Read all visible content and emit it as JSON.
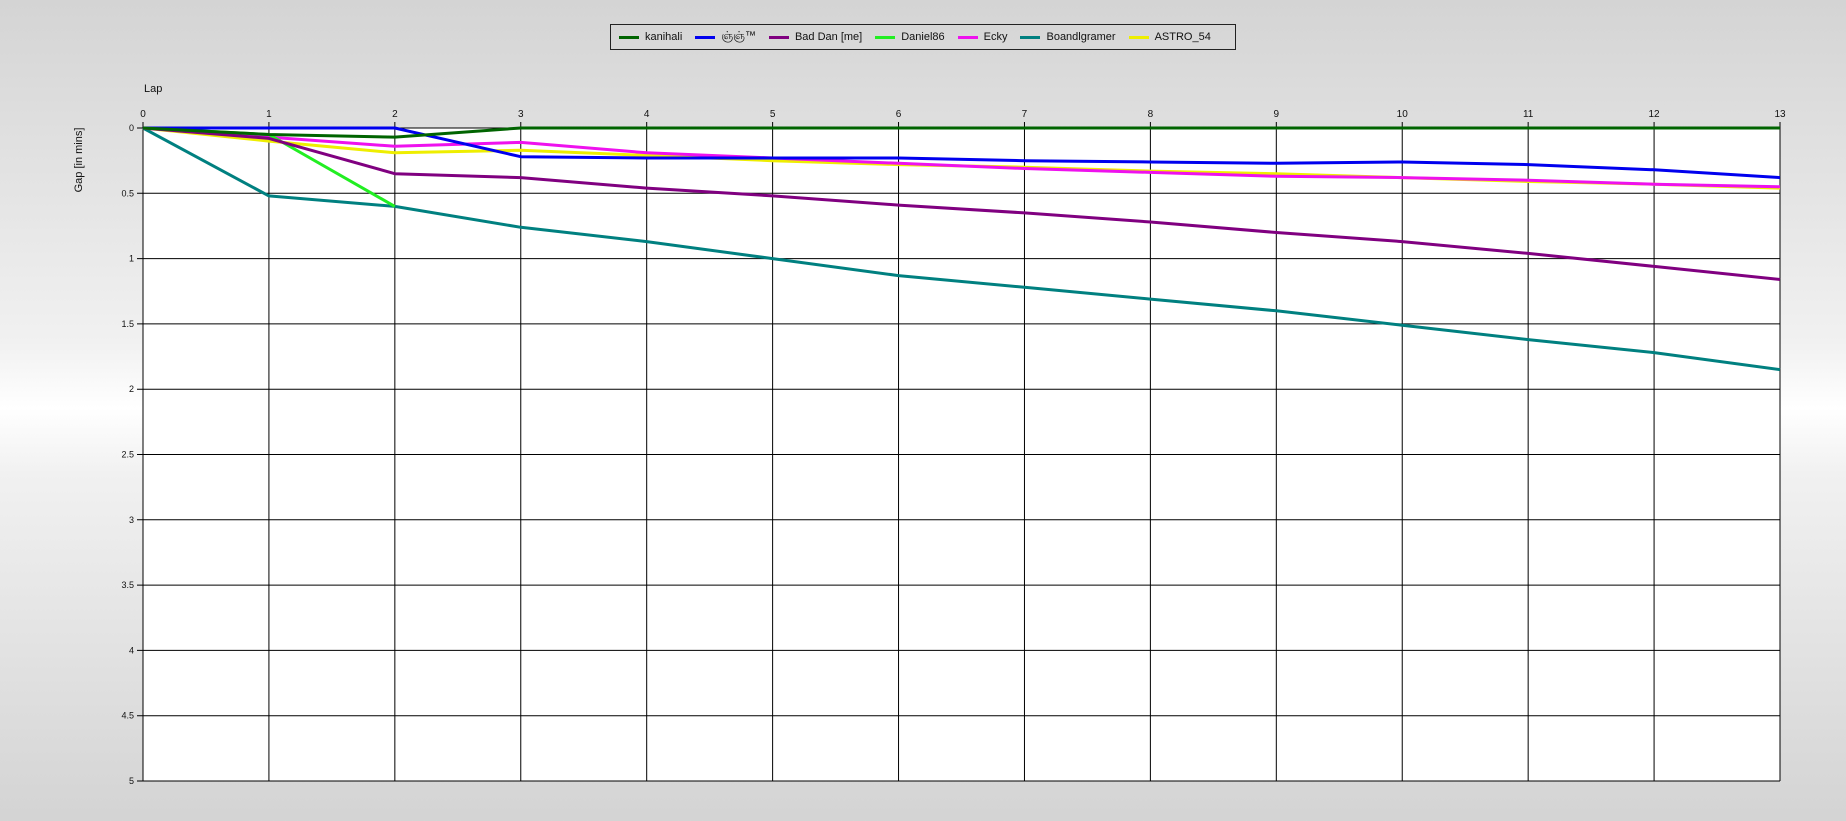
{
  "chart_data": {
    "type": "line",
    "xlabel": "Lap",
    "ylabel": "Gap [in mins]",
    "xlim": [
      0,
      13
    ],
    "ylim": [
      0,
      5
    ],
    "y_inverted": true,
    "x_ticks": [
      0,
      1,
      2,
      3,
      4,
      5,
      6,
      7,
      8,
      9,
      10,
      11,
      12,
      13
    ],
    "y_ticks": [
      0,
      0.5,
      1,
      1.5,
      2,
      2.5,
      3,
      3.5,
      4,
      4.5,
      5
    ],
    "y_tick_labels": [
      "0",
      "0.5",
      "1",
      "1.5",
      "2",
      "2.5",
      "3",
      "3.5",
      "4",
      "4.5",
      "5"
    ],
    "grid": true,
    "legend_position": "top-center",
    "series": [
      {
        "name": "kanihali",
        "color": "#006400",
        "x": [
          0,
          1,
          2,
          3,
          4,
          5,
          6,
          7,
          8,
          9,
          10,
          11,
          12,
          13
        ],
        "values": [
          0,
          0.05,
          0.07,
          0,
          0,
          0,
          0,
          0,
          0,
          0,
          0,
          0,
          0,
          0
        ]
      },
      {
        "name": "ஞ்ஞ்™",
        "color": "#0000ee",
        "x": [
          0,
          1,
          2,
          3,
          4,
          5,
          6,
          7,
          8,
          9,
          10,
          11,
          12,
          13
        ],
        "values": [
          0,
          0,
          0,
          0.22,
          0.23,
          0.23,
          0.23,
          0.25,
          0.26,
          0.27,
          0.26,
          0.28,
          0.32,
          0.38
        ]
      },
      {
        "name": "Bad Dan [me]",
        "color": "#800080",
        "x": [
          0,
          1,
          2,
          3,
          4,
          5,
          6,
          7,
          8,
          9,
          10,
          11,
          12,
          13
        ],
        "values": [
          0,
          0.08,
          0.35,
          0.38,
          0.46,
          0.52,
          0.59,
          0.65,
          0.72,
          0.8,
          0.87,
          0.96,
          1.06,
          1.16
        ]
      },
      {
        "name": "Daniel86",
        "color": "#22ee22",
        "x": [
          0,
          1,
          2
        ],
        "values": [
          0,
          0.05,
          0.6
        ]
      },
      {
        "name": "Ecky",
        "color": "#ee11ee",
        "x": [
          0,
          1,
          2,
          3,
          4,
          5,
          6,
          7,
          8,
          9,
          10,
          11,
          12,
          13
        ],
        "values": [
          0,
          0.07,
          0.14,
          0.11,
          0.19,
          0.23,
          0.27,
          0.31,
          0.34,
          0.37,
          0.38,
          0.4,
          0.43,
          0.45
        ]
      },
      {
        "name": "Boandlgramer",
        "color": "#008080",
        "x": [
          0,
          1,
          2,
          3,
          4,
          5,
          6,
          7,
          8,
          9,
          10,
          11,
          12,
          13
        ],
        "values": [
          0,
          0.52,
          0.6,
          0.76,
          0.87,
          1,
          1.13,
          1.22,
          1.31,
          1.4,
          1.51,
          1.62,
          1.72,
          1.85
        ]
      },
      {
        "name": "ASTRO_54",
        "color": "#eeee00",
        "x": [
          0,
          1,
          2,
          3,
          4,
          5,
          6,
          7,
          8,
          9,
          10,
          11,
          12,
          13
        ],
        "values": [
          0,
          0.1,
          0.19,
          0.17,
          0.21,
          0.25,
          0.28,
          0.3,
          0.33,
          0.35,
          0.38,
          0.41,
          0.43,
          0.46
        ]
      }
    ]
  }
}
